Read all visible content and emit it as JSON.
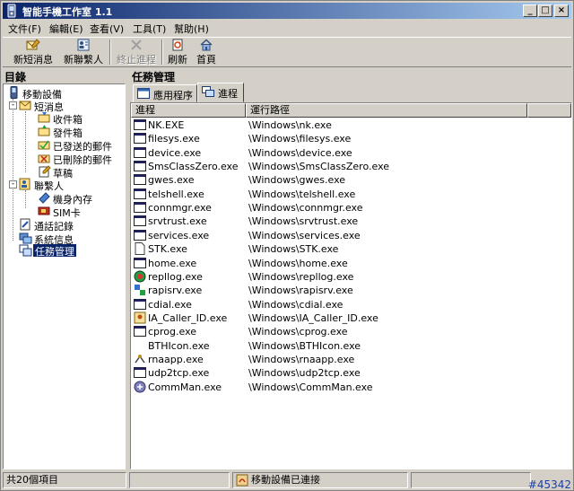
{
  "window": {
    "title": "智能手機工作室 1.1",
    "controls": {
      "minimize": "_",
      "maximize": "□",
      "close": "×"
    }
  },
  "menu": {
    "items": [
      "文件(F)",
      "編輯(E)",
      "查看(V)",
      "工具(T)",
      "幫助(H)"
    ]
  },
  "toolbar": {
    "buttons": [
      {
        "label": "新短消息",
        "icon": "new-message-icon",
        "enabled": true
      },
      {
        "label": "新聯繫人",
        "icon": "new-contact-icon",
        "enabled": true
      },
      {
        "label": "終止進程",
        "icon": "terminate-process-icon",
        "enabled": false
      },
      {
        "label": "刷新",
        "icon": "refresh-icon",
        "enabled": true
      },
      {
        "label": "首頁",
        "icon": "home-icon",
        "enabled": true
      }
    ]
  },
  "left_pane": {
    "header": "目錄",
    "tree": [
      {
        "label": "移動設備",
        "icon": "device-icon",
        "expander": ""
      },
      {
        "label": "短消息",
        "icon": "messages-icon",
        "expander": "-"
      },
      {
        "label": "收件箱",
        "icon": "inbox-icon",
        "expander": ""
      },
      {
        "label": "發件箱",
        "icon": "outbox-icon",
        "expander": ""
      },
      {
        "label": "已發送的郵件",
        "icon": "sent-icon",
        "expander": ""
      },
      {
        "label": "已刪除的郵件",
        "icon": "deleted-icon",
        "expander": ""
      },
      {
        "label": "草稿",
        "icon": "drafts-icon",
        "expander": ""
      },
      {
        "label": "聯繫人",
        "icon": "contacts-icon",
        "expander": "-"
      },
      {
        "label": "機身內存",
        "icon": "phone-memory-icon",
        "expander": ""
      },
      {
        "label": "SIM卡",
        "icon": "sim-card-icon",
        "expander": ""
      },
      {
        "label": "通話記錄",
        "icon": "call-log-icon",
        "expander": ""
      },
      {
        "label": "系統信息",
        "icon": "system-info-icon",
        "expander": ""
      },
      {
        "label": "任務管理",
        "icon": "task-manager-icon",
        "expander": "",
        "selected": true
      }
    ]
  },
  "right_pane": {
    "header": "任務管理",
    "tabs": [
      {
        "label": "應用程序",
        "active": false
      },
      {
        "label": "進程",
        "active": true
      }
    ],
    "columns": [
      "進程",
      "運行路徑"
    ],
    "rows": [
      {
        "name": "NK.EXE",
        "path": "\\Windows\\nk.exe",
        "icon": "window-icon"
      },
      {
        "name": "filesys.exe",
        "path": "\\Windows\\filesys.exe",
        "icon": "window-icon"
      },
      {
        "name": "device.exe",
        "path": "\\Windows\\device.exe",
        "icon": "window-icon"
      },
      {
        "name": "SmsClassZero.exe",
        "path": "\\Windows\\SmsClassZero.exe",
        "icon": "window-icon"
      },
      {
        "name": "gwes.exe",
        "path": "\\Windows\\gwes.exe",
        "icon": "window-icon"
      },
      {
        "name": "telshell.exe",
        "path": "\\Windows\\telshell.exe",
        "icon": "window-icon"
      },
      {
        "name": "connmgr.exe",
        "path": "\\Windows\\connmgr.exe",
        "icon": "window-icon"
      },
      {
        "name": "srvtrust.exe",
        "path": "\\Windows\\srvtrust.exe",
        "icon": "window-icon"
      },
      {
        "name": "services.exe",
        "path": "\\Windows\\services.exe",
        "icon": "window-icon"
      },
      {
        "name": "STK.exe",
        "path": "\\Windows\\STK.exe",
        "icon": "document-icon"
      },
      {
        "name": "home.exe",
        "path": "\\Windows\\home.exe",
        "icon": "window-icon"
      },
      {
        "name": "repllog.exe",
        "path": "\\Windows\\repllog.exe",
        "icon": "sync-icon"
      },
      {
        "name": "rapisrv.exe",
        "path": "\\Windows\\rapisrv.exe",
        "icon": "rapi-icon"
      },
      {
        "name": "cdial.exe",
        "path": "\\Windows\\cdial.exe",
        "icon": "window-icon"
      },
      {
        "name": "IA_Caller_ID.exe",
        "path": "\\Windows\\IA_Caller_ID.exe",
        "icon": "caller-id-icon"
      },
      {
        "name": "cprog.exe",
        "path": "\\Windows\\cprog.exe",
        "icon": "window-icon"
      },
      {
        "name": "BTHIcon.exe",
        "path": "\\Windows\\BTHIcon.exe",
        "icon": "blank-icon"
      },
      {
        "name": "rnaapp.exe",
        "path": "\\Windows\\rnaapp.exe",
        "icon": "network-icon"
      },
      {
        "name": "udp2tcp.exe",
        "path": "\\Windows\\udp2tcp.exe",
        "icon": "window-icon"
      },
      {
        "name": "CommMan.exe",
        "path": "\\Windows\\CommMan.exe",
        "icon": "comm-manager-icon"
      }
    ]
  },
  "status_bar": {
    "count": "共20個項目",
    "middle": "",
    "connection": "移動設備已連接",
    "extra": ""
  },
  "watermark": "#45342",
  "colors": {
    "titlebar_start": "#0a246a",
    "titlebar_end": "#a6caf0",
    "selection": "#0a246a",
    "face": "#d4d0c8"
  }
}
